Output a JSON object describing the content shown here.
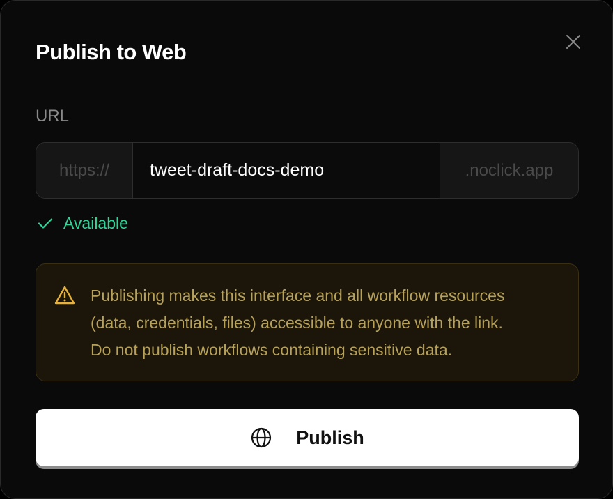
{
  "dialog": {
    "title": "Publish to Web",
    "close_icon": "close-icon"
  },
  "url": {
    "label": "URL",
    "prefix": "https://",
    "slug": "tweet-draft-docs-demo",
    "suffix": ".noclick.app"
  },
  "availability": {
    "icon": "check-icon",
    "text": "Available",
    "color": "#34d399"
  },
  "warning": {
    "icon": "warning-triangle-icon",
    "lines": [
      "Publishing makes this interface and all workflow resources",
      "(data, credentials, files) accessible to anyone with the link.",
      "Do not publish workflows containing sensitive data."
    ],
    "color": "#b8a25a"
  },
  "publish_button": {
    "icon": "globe-icon",
    "label": "Publish"
  }
}
